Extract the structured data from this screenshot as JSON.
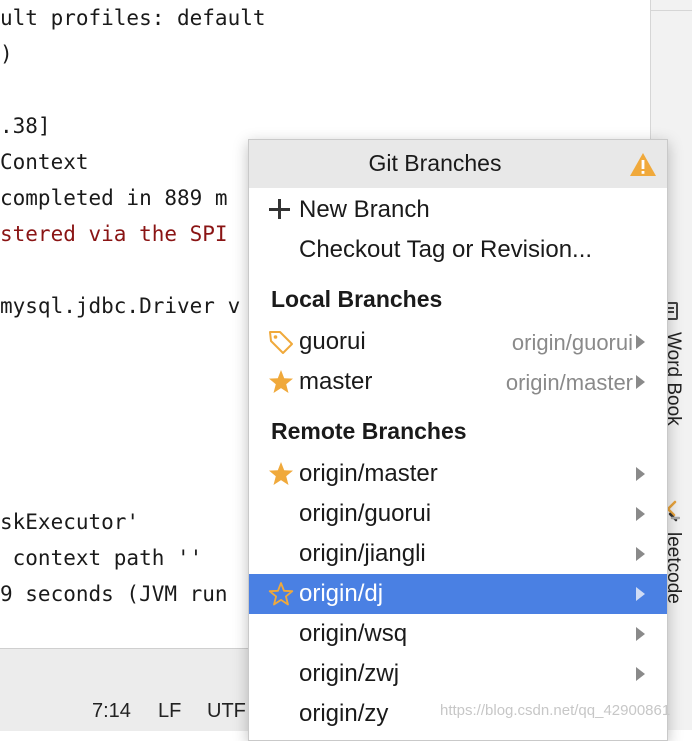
{
  "console": {
    "lines": [
      {
        "text": "ult profiles: default",
        "color": "#1a1a1a"
      },
      {
        "text": ")",
        "color": "#1a1a1a"
      },
      {
        "text": "",
        "color": "#1a1a1a"
      },
      {
        "text": ".38]",
        "color": "#1a1a1a"
      },
      {
        "text": "Context",
        "color": "#1a1a1a"
      },
      {
        "text": "completed in 889 m",
        "color": "#1a1a1a"
      },
      {
        "text": "stered via the SPI",
        "color": "#8a1414"
      },
      {
        "text": "",
        "color": "#1a1a1a"
      },
      {
        "text": "mysql.jdbc.Driver v",
        "color": "#1a1a1a"
      },
      {
        "text": "",
        "color": "#1a1a1a"
      },
      {
        "text": "",
        "color": "#1a1a1a"
      },
      {
        "text": "",
        "color": "#1a1a1a"
      },
      {
        "text": "",
        "color": "#1a1a1a"
      },
      {
        "text": "",
        "color": "#1a1a1a"
      },
      {
        "text": "skExecutor'",
        "color": "#1a1a1a"
      },
      {
        "text": " context path ''",
        "color": "#1a1a1a"
      },
      {
        "text": "9 seconds (JVM run",
        "color": "#1a1a1a"
      }
    ]
  },
  "tool_strip": {
    "word_book": "Word Book",
    "leetcode": "leetcode"
  },
  "status_bar": {
    "position": "7:14",
    "line_ending": "LF",
    "encoding": "UTF"
  },
  "popup": {
    "title": "Git Branches",
    "warning_icon": "warning-icon",
    "actions": {
      "new_branch": "New Branch",
      "checkout": "Checkout Tag or Revision..."
    },
    "local_header": "Local Branches",
    "local_branches": [
      {
        "name": "guorui",
        "tracking": "origin/guorui",
        "icon": "tag-icon"
      },
      {
        "name": "master",
        "tracking": "origin/master",
        "icon": "star-filled-icon"
      }
    ],
    "remote_header": "Remote Branches",
    "remote_branches": [
      {
        "name": "origin/master",
        "icon": "star-filled-icon",
        "selected": false
      },
      {
        "name": "origin/guorui",
        "icon": "",
        "selected": false
      },
      {
        "name": "origin/jiangli",
        "icon": "",
        "selected": false
      },
      {
        "name": "origin/dj",
        "icon": "star-outline-icon",
        "selected": true
      },
      {
        "name": "origin/wsq",
        "icon": "",
        "selected": false
      },
      {
        "name": "origin/zwj",
        "icon": "",
        "selected": false
      },
      {
        "name": "origin/zy",
        "icon": "",
        "selected": false
      }
    ]
  },
  "watermark": "https://blog.csdn.net/qq_42900861",
  "colors": {
    "selection": "#4a80e3",
    "star": "#f0a93b",
    "warning": "#f0a93b",
    "error_text": "#8a1414"
  }
}
